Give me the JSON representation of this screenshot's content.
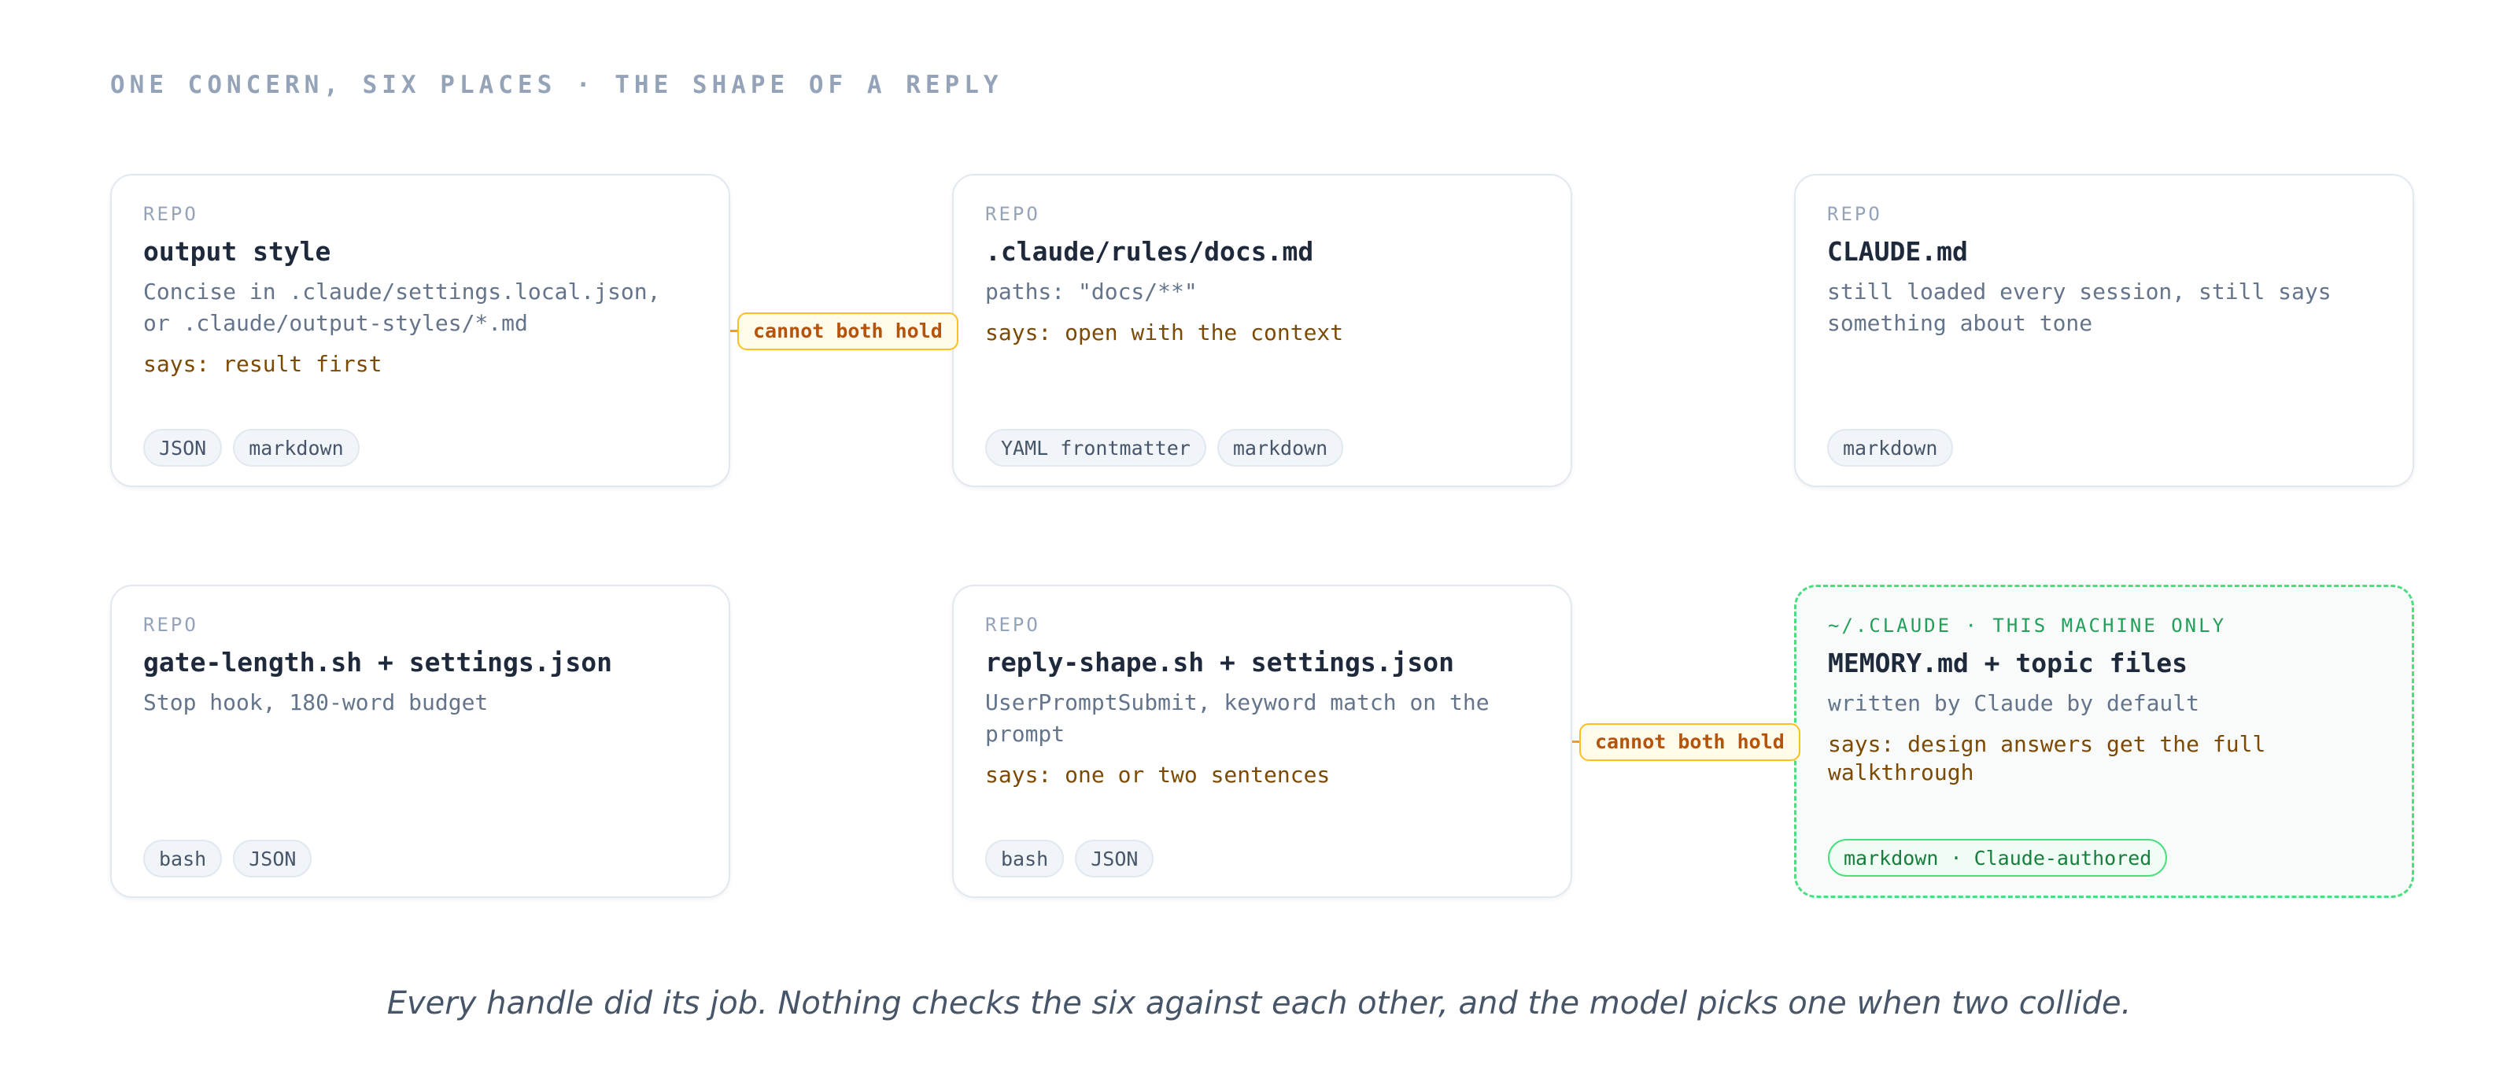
{
  "heading": "ONE CONCERN, SIX PLACES · THE SHAPE OF A REPLY",
  "cards": [
    {
      "scope": "REPO",
      "title": "output style",
      "description": "Concise in .claude/settings.local.json, or .claude/output-styles/*.md",
      "says": "says: result first",
      "tags": [
        "JSON",
        "markdown"
      ]
    },
    {
      "scope": "REPO",
      "title": ".claude/rules/docs.md",
      "description": "paths: \"docs/**\"",
      "says": "says: open with the context",
      "tags": [
        "YAML frontmatter",
        "markdown"
      ]
    },
    {
      "scope": "REPO",
      "title": "CLAUDE.md",
      "description": "still loaded every session, still says something about tone",
      "says": "",
      "tags": [
        "markdown"
      ]
    },
    {
      "scope": "REPO",
      "title": "gate-length.sh + settings.json",
      "description": "Stop hook, 180-word budget",
      "says": "",
      "tags": [
        "bash",
        "JSON"
      ]
    },
    {
      "scope": "REPO",
      "title": "reply-shape.sh + settings.json",
      "description": "UserPromptSubmit, keyword match on the prompt",
      "says": "says: one or two sentences",
      "tags": [
        "bash",
        "JSON"
      ]
    },
    {
      "scope": "~/.CLAUDE · THIS MACHINE ONLY",
      "title": "MEMORY.md + topic files",
      "description": "written by Claude by default",
      "says": "says: design answers get the full walkthrough",
      "tags": [
        "markdown · Claude-authored"
      ]
    }
  ],
  "conflicts": [
    {
      "label": "cannot both hold"
    },
    {
      "label": "cannot both hold"
    }
  ],
  "caption": "Every handle did its job. Nothing checks the six against each other, and the model picks one when two collide.",
  "colors": {
    "conflict_accent": "#f59e0b",
    "machine_accent": "#4ade80",
    "says_text": "#7c4a03"
  }
}
